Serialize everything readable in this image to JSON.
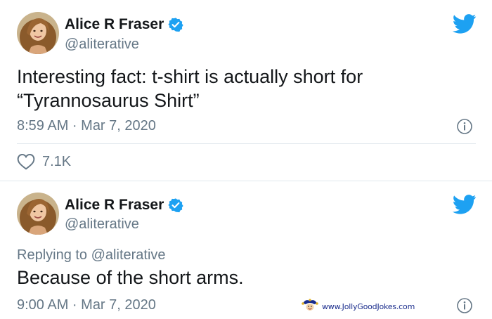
{
  "tweets": [
    {
      "display_name": "Alice R Fraser",
      "handle": "@aliterative",
      "text": "Interesting fact: t-shirt is actually short for\n“Tyrannosaurus Shirt”",
      "timestamp": "8:59 AM · Mar 7, 2020",
      "likes": "7.1K"
    },
    {
      "display_name": "Alice R Fraser",
      "handle": "@aliterative",
      "replying_prefix": "Replying to ",
      "replying_handle": "@aliterative",
      "text": "Because of the short arms.",
      "timestamp": "9:00 AM · Mar 7, 2020"
    }
  ],
  "watermark": {
    "text": "www.JollyGoodJokes.com"
  },
  "colors": {
    "twitter_blue": "#1da1f2",
    "secondary_text": "#657786",
    "primary_text": "#14171a",
    "divider": "#e1e8ed"
  },
  "icons": [
    "avatar",
    "verified-badge-icon",
    "twitter-bird-icon",
    "info-icon",
    "heart-icon",
    "jester-logo-icon"
  ]
}
